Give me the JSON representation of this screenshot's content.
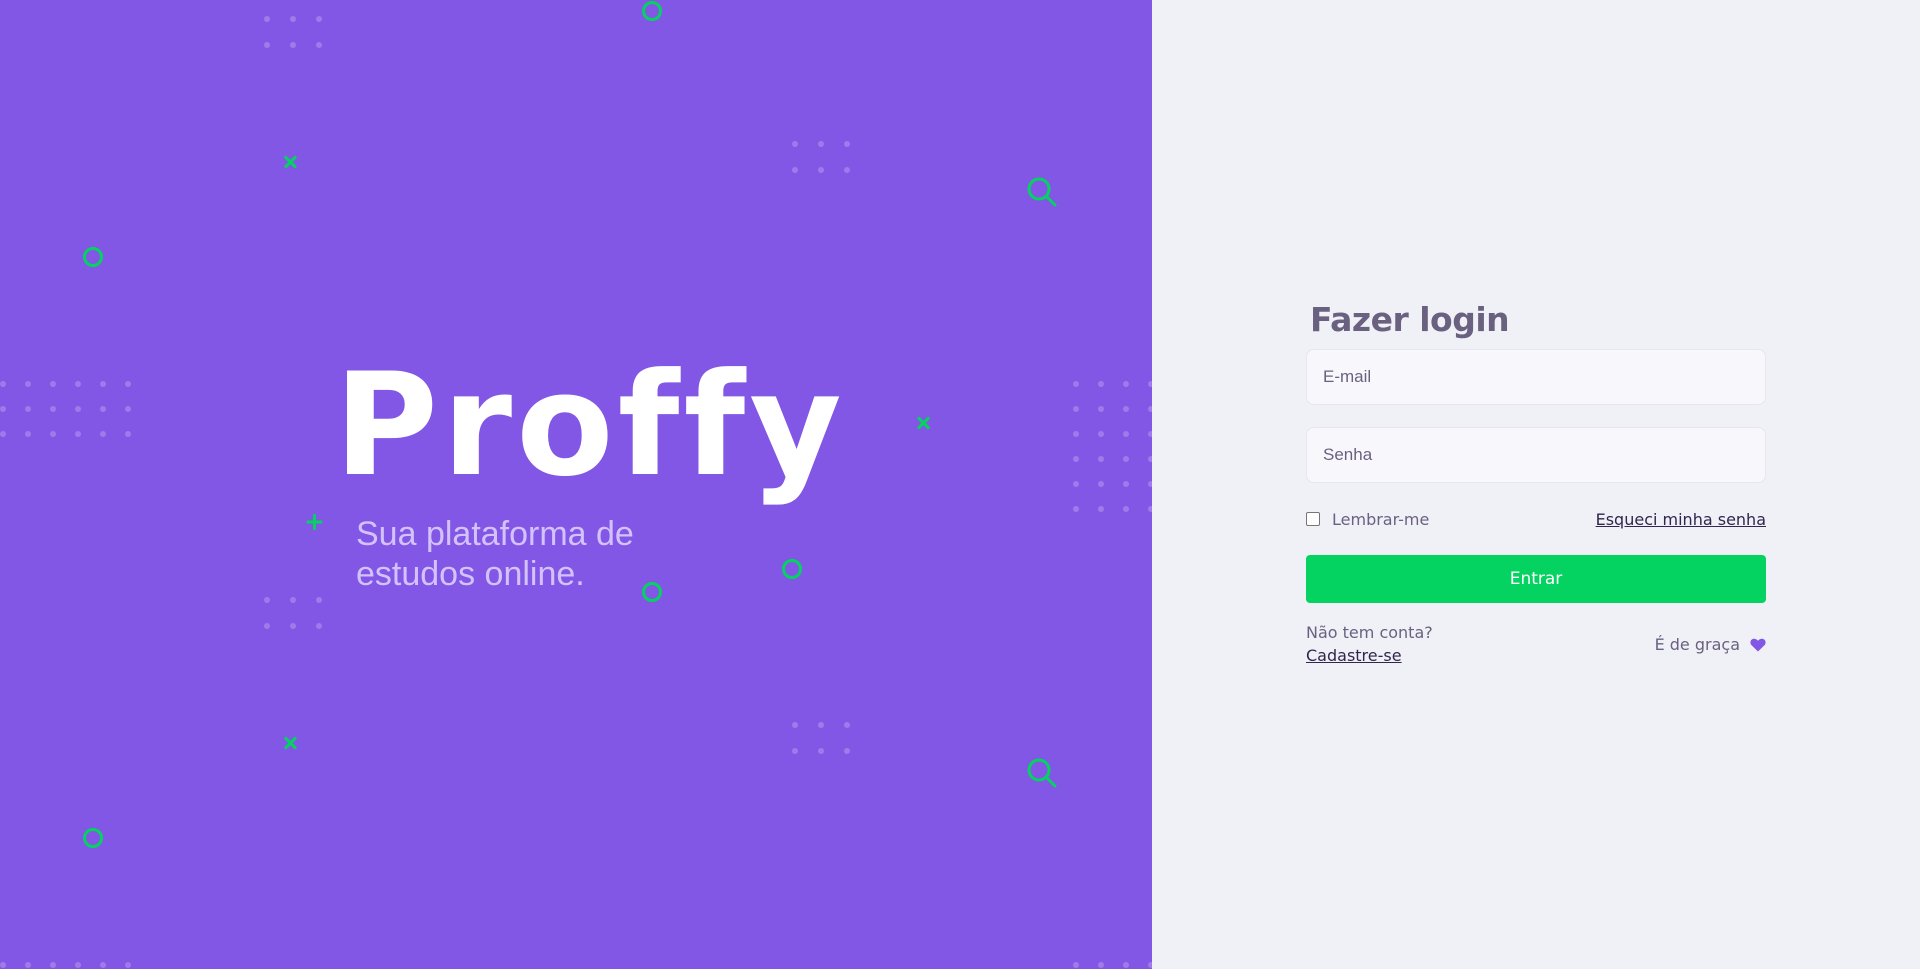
{
  "brand": {
    "logo": "Proffy",
    "tagline_line1": "Sua plataforma de",
    "tagline_line2": "estudos online."
  },
  "login": {
    "title": "Fazer login",
    "email_placeholder": "E-mail",
    "password_placeholder": "Senha",
    "remember_label": "Lembrar-me",
    "forgot_link": "Esqueci minha senha",
    "submit_label": "Entrar",
    "no_account_text": "Não tem conta?",
    "signup_link": "Cadastre-se",
    "free_text": "É de graça"
  },
  "colors": {
    "primary": "#8257E5",
    "accent_green": "#04D361",
    "background": "#F0F0F7",
    "title_text": "#6A6180"
  },
  "icons": [
    "heart-icon",
    "circle-decoration",
    "x-decoration",
    "plus-decoration",
    "magnifier-decoration",
    "dot-grid-decoration"
  ]
}
